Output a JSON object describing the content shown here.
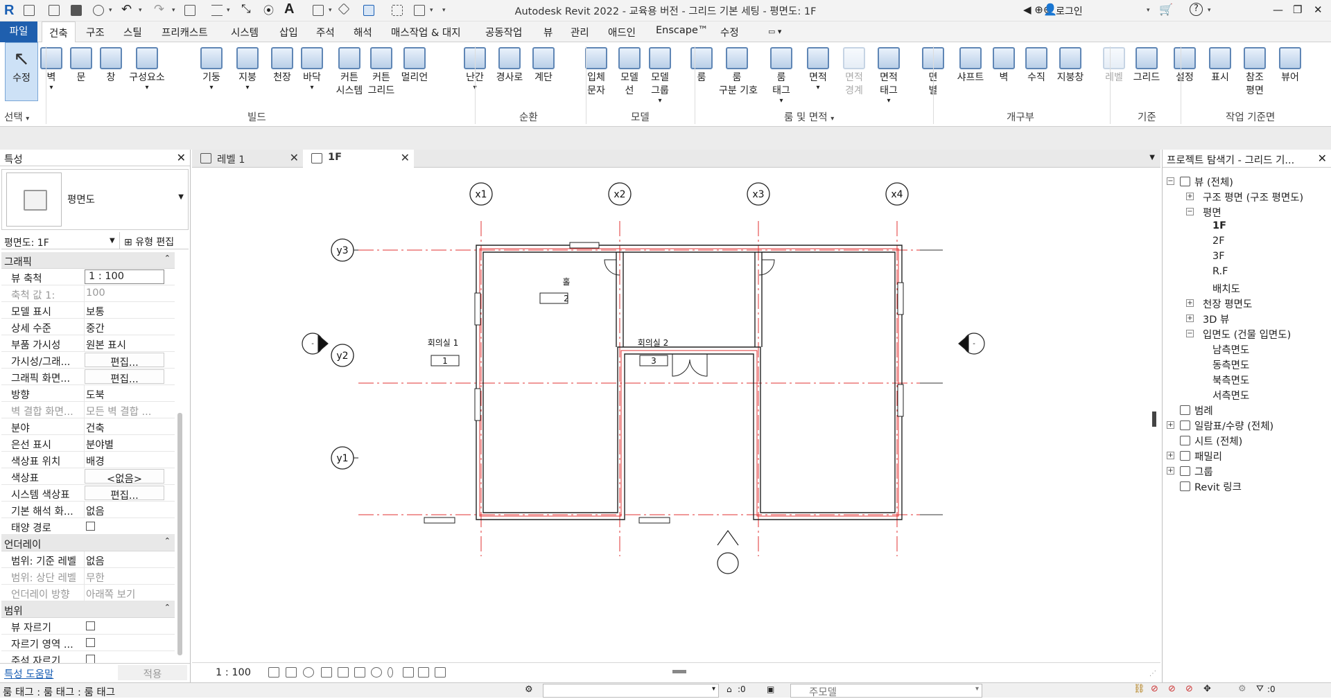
{
  "app": {
    "title": "Autodesk Revit 2022 - 교육용 버전 - 그리드 기본 세팅 - 평면도: 1F",
    "login": "로그인"
  },
  "tabs": [
    "파일",
    "건축",
    "구조",
    "스틸",
    "프리캐스트",
    "시스템",
    "삽입",
    "주석",
    "해석",
    "매스작업 & 대지",
    "공동작업",
    "뷰",
    "관리",
    "애드인",
    "Enscape™",
    "수정"
  ],
  "ribbon": {
    "select": {
      "label": "수정",
      "sub": "선택"
    },
    "buttons": [
      {
        "label": "벽",
        "dd": true
      },
      {
        "label": "문"
      },
      {
        "label": "창"
      },
      {
        "label": "구성요소",
        "dd": true
      },
      {
        "label": "기둥",
        "dd": true
      },
      {
        "label": "지붕",
        "dd": true
      },
      {
        "label": "천장"
      },
      {
        "label": "바닥",
        "dd": true
      },
      {
        "label": "커튼\n시스템"
      },
      {
        "label": "커튼\n그리드"
      },
      {
        "label": "멀리언"
      },
      {
        "label": "난간",
        "dd": true
      },
      {
        "label": "경사로"
      },
      {
        "label": "계단"
      },
      {
        "label": "입체\n문자"
      },
      {
        "label": "모델\n선"
      },
      {
        "label": "모델\n그룹",
        "dd": true
      },
      {
        "label": "룸"
      },
      {
        "label": "룸\n구분 기호"
      },
      {
        "label": "룸\n태그",
        "dd": true
      },
      {
        "label": "면적",
        "dd": true
      },
      {
        "label": "면적\n경계",
        "disabled": true
      },
      {
        "label": "면적\n태그",
        "dd": true
      },
      {
        "label": "면\n별"
      },
      {
        "label": "샤프트"
      },
      {
        "label": "벽"
      },
      {
        "label": "수직"
      },
      {
        "label": "지붕창"
      },
      {
        "label": "레벨",
        "disabled": true
      },
      {
        "label": "그리드"
      },
      {
        "label": "설정"
      },
      {
        "label": "표시"
      },
      {
        "label": "참조\n평면"
      },
      {
        "label": "뷰어"
      }
    ],
    "panels": [
      "빌드",
      "순환",
      "모델",
      "룸 및 면적",
      "개구부",
      "기준",
      "작업 기준면"
    ]
  },
  "properties": {
    "title": "특성",
    "type_name": "평면도",
    "instance": "평면도: 1F",
    "edit_type": "유형 편집",
    "groups": [
      {
        "name": "그래픽",
        "rows": [
          {
            "k": "뷰 축척",
            "v": "1 : 100",
            "kind": "box"
          },
          {
            "k": "축척 값    1:",
            "v": "100",
            "dim": true
          },
          {
            "k": "모델 표시",
            "v": "보통"
          },
          {
            "k": "상세 수준",
            "v": "중간"
          },
          {
            "k": "부품 가시성",
            "v": "원본 표시"
          },
          {
            "k": "가시성/그래...",
            "v": "편집...",
            "kind": "btn"
          },
          {
            "k": "그래픽 화면...",
            "v": "편집...",
            "kind": "btn"
          },
          {
            "k": "방향",
            "v": "도북"
          },
          {
            "k": "벽 결합 화면...",
            "v": "모든 벽 결합 ...",
            "dim": true
          },
          {
            "k": "분야",
            "v": "건축"
          },
          {
            "k": "은선 표시",
            "v": "분야별"
          },
          {
            "k": "색상표 위치",
            "v": "배경"
          },
          {
            "k": "색상표",
            "v": "<없음>",
            "kind": "btn"
          },
          {
            "k": "시스템 색상표",
            "v": "편집...",
            "kind": "btn"
          },
          {
            "k": "기본 해석 화...",
            "v": "없음"
          },
          {
            "k": "태양 경로",
            "v": "",
            "kind": "cb"
          }
        ]
      },
      {
        "name": "언더레이",
        "rows": [
          {
            "k": "범위: 기준 레벨",
            "v": "없음"
          },
          {
            "k": "범위: 상단 레벨",
            "v": "무한",
            "dim": true
          },
          {
            "k": "언더레이 방향",
            "v": "아래쪽 보기",
            "dim": true
          }
        ]
      },
      {
        "name": "범위",
        "rows": [
          {
            "k": "뷰 자르기",
            "v": "",
            "kind": "cb"
          },
          {
            "k": "자르기 영역 ...",
            "v": "",
            "kind": "cb"
          },
          {
            "k": "주석 자르기",
            "v": "",
            "kind": "cb"
          }
        ]
      }
    ],
    "help_link": "특성 도움말",
    "apply": "적용"
  },
  "view_tabs": [
    {
      "label": "레벨 1"
    },
    {
      "label": "1F",
      "active": true
    }
  ],
  "canvas": {
    "grids_x": [
      "x1",
      "x2",
      "x3",
      "x4"
    ],
    "grids_y": [
      "y3",
      "y2",
      "y1"
    ],
    "rooms": [
      {
        "name": "홀",
        "number": "2"
      },
      {
        "name": "회의실 1",
        "number": "1"
      },
      {
        "name": "회의실 2",
        "number": "3"
      }
    ],
    "scale": "1 : 100",
    "colors": {
      "grid": "#e03030",
      "wall": "#222222",
      "wall_red": "#e03030"
    }
  },
  "browser": {
    "title": "프로젝트 탐색기 - 그리드 기...",
    "items": [
      {
        "label": "뷰 (전체)"
      },
      {
        "label": "구조 평면 (구조 평면도)"
      },
      {
        "label": "평면"
      },
      {
        "label": "1F",
        "bold": true
      },
      {
        "label": "2F"
      },
      {
        "label": "3F"
      },
      {
        "label": "R.F"
      },
      {
        "label": "배치도"
      },
      {
        "label": "천장 평면도"
      },
      {
        "label": "3D 뷰"
      },
      {
        "label": "입면도 (건물 입면도)"
      },
      {
        "label": "남측면도"
      },
      {
        "label": "동측면도"
      },
      {
        "label": "북측면도"
      },
      {
        "label": "서측면도"
      },
      {
        "label": "범례"
      },
      {
        "label": "일람표/수량 (전체)"
      },
      {
        "label": "시트 (전체)"
      },
      {
        "label": "패밀리"
      },
      {
        "label": "그룹"
      },
      {
        "label": "Revit 링크"
      }
    ]
  },
  "status": {
    "text": "룸 태그 : 룸 태그 : 룸 태그",
    "combo": "주모델",
    "zero": ":0"
  }
}
